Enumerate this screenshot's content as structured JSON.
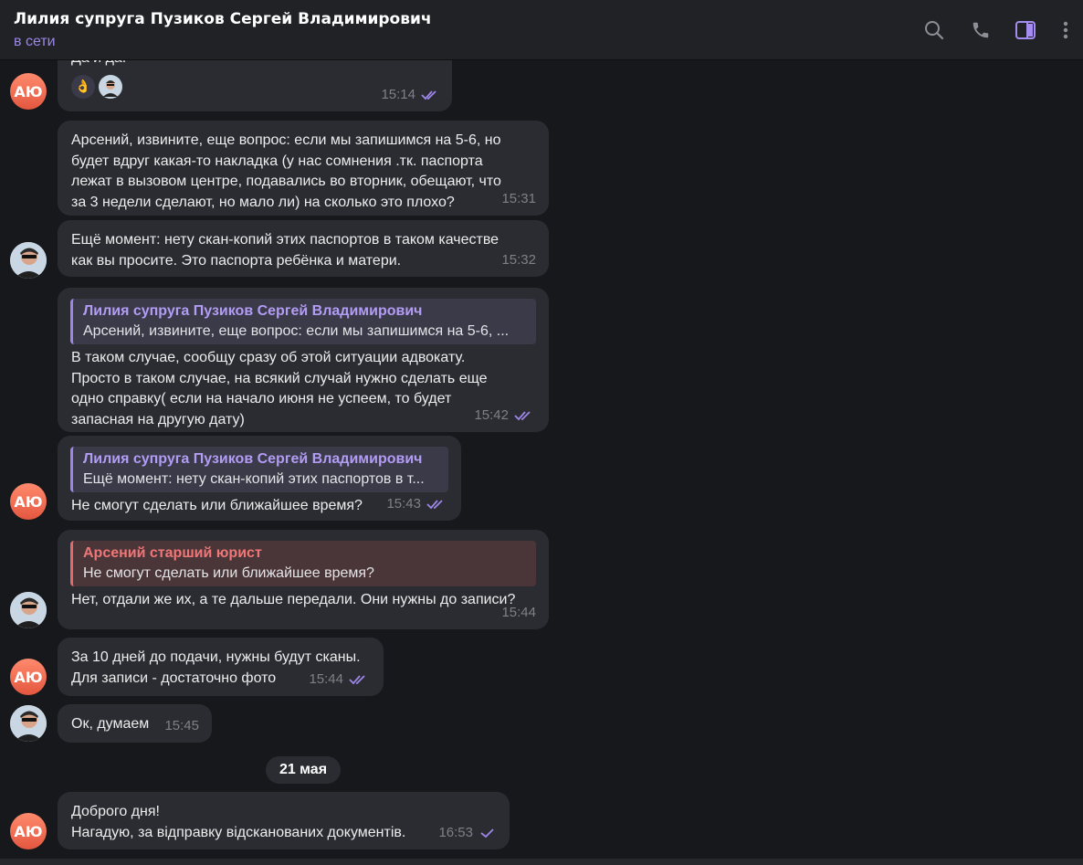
{
  "header": {
    "title": "Лилия супруга Пузиков Сергей Владимирович",
    "status": "в сети"
  },
  "icons": {
    "search": "search-icon",
    "call": "phone-icon",
    "sidebar": "sidebar-toggle-icon",
    "more": "more-vertical-icon"
  },
  "colors": {
    "accent": "#9d86e8",
    "bubble": "#2b2c31",
    "background": "#17181c",
    "avatar_initials": "#e3573f",
    "reply_red": "#e26a6a"
  },
  "avatars": {
    "initials": "АЮ"
  },
  "messages": [
    {
      "text": "Да и да.",
      "time": "15:14",
      "reactions": [
        "👌",
        "🧑"
      ]
    },
    {
      "text": "Арсений, извините, еще вопрос: если мы запишимся на 5-6, но\nбудет вдруг  какая-то накладка (у нас сомнения .тк. паспорта\nлежат в вызовом центре, подавались во вторник, обещают, что\nза  3 недели сделают, но мало ли) на сколько это плохо?",
      "time": "15:31"
    },
    {
      "text": "Ещё момент: нету скан-копий этих паспортов в таком качестве\nкак вы просите. Это паспорта ребёнка и матери.",
      "time": "15:32"
    },
    {
      "reply_name": "Лилия супруга Пузиков Сергей Владимирович",
      "reply_text": "Арсений, извините, еще вопрос: если мы запишимся на 5-6, ...",
      "text": "В таком случае, сообщу сразу об этой ситуации адвокату.\nПросто в таком случае, на всякий случай нужно сделать еще\nодно справку( если на начало июня не успеем, то будет\nзапасная на другую дату)",
      "time": "15:42"
    },
    {
      "reply_name": "Лилия супруга Пузиков Сергей Владимирович",
      "reply_text": "Ещё момент: нету скан-копий этих паспортов в т...",
      "text": "Не смогут сделать или ближайшее время?",
      "time": "15:43"
    },
    {
      "reply_name": "Арсений старший юрист",
      "reply_text": "Не смогут сделать или ближайшее время?",
      "text": "Нет, отдали же их, а те дальше передали. Они нужны до записи?",
      "time": "15:44"
    },
    {
      "text": "За 10 дней до подачи, нужны будут сканы.\nДля записи - достаточно фото",
      "time": "15:44"
    },
    {
      "text": "Ок, думаем",
      "time": "15:45"
    },
    {
      "text": "Доброго дня!\nНагадую, за відправку відсканованих документів.",
      "time": "16:53"
    }
  ],
  "date_separator": "21 мая"
}
